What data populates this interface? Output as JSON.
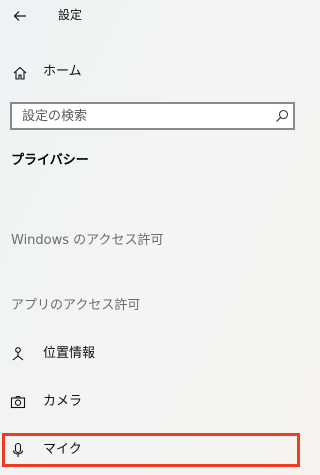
{
  "header": {
    "title": "設定",
    "back_icon": "arrow-left-icon"
  },
  "home": {
    "label": "ホーム",
    "icon": "home-icon"
  },
  "search": {
    "placeholder": "設定の検索",
    "icon": "search-icon"
  },
  "section": {
    "title": "プライバシー"
  },
  "groups": {
    "windows_permissions": "Windows のアクセス許可",
    "app_permissions": "アプリのアクセス許可"
  },
  "nav_items": [
    {
      "label": "位置情報",
      "icon": "location-icon"
    },
    {
      "label": "カメラ",
      "icon": "camera-icon"
    },
    {
      "label": "マイク",
      "icon": "microphone-icon",
      "highlighted": true
    }
  ],
  "colors": {
    "highlight": "#ee3b22",
    "group_label": "#6d6d6d"
  }
}
